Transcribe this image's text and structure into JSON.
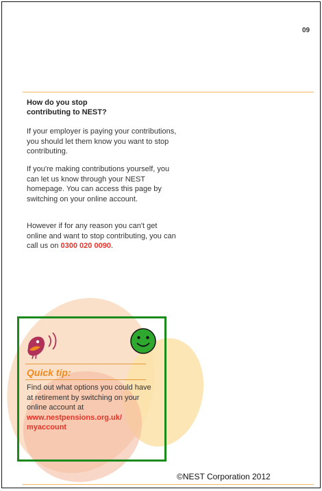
{
  "page": {
    "number": "09"
  },
  "section": {
    "heading_line1": "How do you stop",
    "heading_line2": "contributing to NEST?",
    "paragraph1": "If your employer is paying your contributions, you should let them know you want to stop contributing.",
    "paragraph2": "If you're making contributions yourself, you can let us know through your NEST homepage. You can access this page by switching on your online account.",
    "paragraph3_text": "However if for any reason you can't get online and want to stop contributing, you can call us on ",
    "paragraph3_phone": "0300 020 0090",
    "paragraph3_end": "."
  },
  "tip": {
    "title": "Quick tip:",
    "text": "Find out what options you could have at retirement by switching on your online account at ",
    "link_line1": "www.nestpensions.org.uk/",
    "link_line2": "myaccount"
  },
  "footer": {
    "copyright": "©NEST Corporation 2012"
  },
  "icons": {
    "logo": "nest-bird-logo-icon",
    "annotation": "smiley-face-icon"
  },
  "colors": {
    "accent_orange": "#f08a1c",
    "link_red": "#e6332a",
    "rule": "#f5b55c",
    "annotation_green": "#1a8a1a",
    "smiley_green": "#2fa82f"
  }
}
